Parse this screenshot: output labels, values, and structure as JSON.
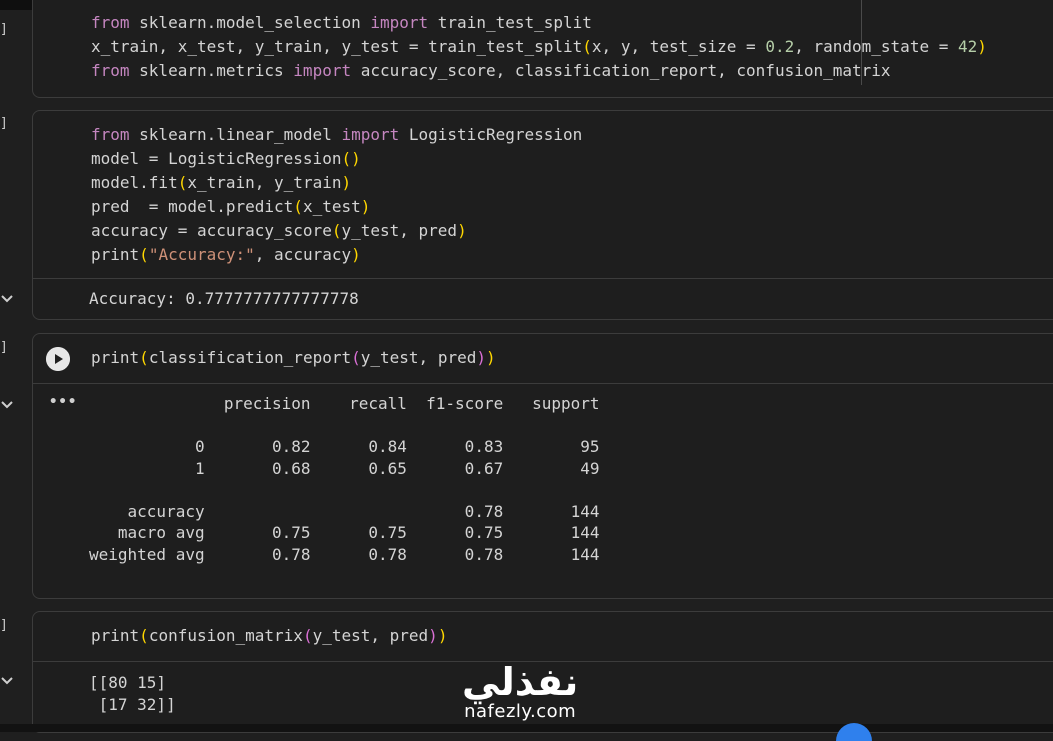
{
  "cells": [
    {
      "bracket": "]",
      "code": [
        "from sklearn.model_selection import train_test_split",
        "x_train, x_test, y_train, y_test = train_test_split(x, y, test_size = 0.2, random_state = 42)",
        "from sklearn.metrics import accuracy_score, classification_report, confusion_matrix"
      ]
    },
    {
      "bracket": "]",
      "code": [
        "from sklearn.linear_model import LogisticRegression",
        "model = LogisticRegression()",
        "model.fit(x_train, y_train)",
        "pred  = model.predict(x_test)",
        "accuracy = accuracy_score(y_test, pred)",
        "print(\"Accuracy:\", accuracy)"
      ],
      "output": "Accuracy: 0.7777777777777778"
    },
    {
      "bracket": "]",
      "code": [
        "print(classification_report(y_test, pred))"
      ],
      "output_menu": "•••",
      "output": "              precision    recall  f1-score   support\n\n           0       0.82      0.84      0.83        95\n           1       0.68      0.65      0.67        49\n\n    accuracy                           0.78       144\n   macro avg       0.75      0.75      0.75       144\nweighted avg       0.78      0.78      0.78       144"
    },
    {
      "bracket": "]",
      "code": [
        "print(confusion_matrix(y_test, pred))"
      ],
      "output": "[[80 15]\n [17 32]]"
    }
  ],
  "watermark": {
    "arabic": "نفذلي",
    "url": "nafezly.com"
  },
  "icons": {
    "run": "play-icon",
    "collapse": "chevron-down-icon",
    "menu": "more-horiz-icon"
  }
}
